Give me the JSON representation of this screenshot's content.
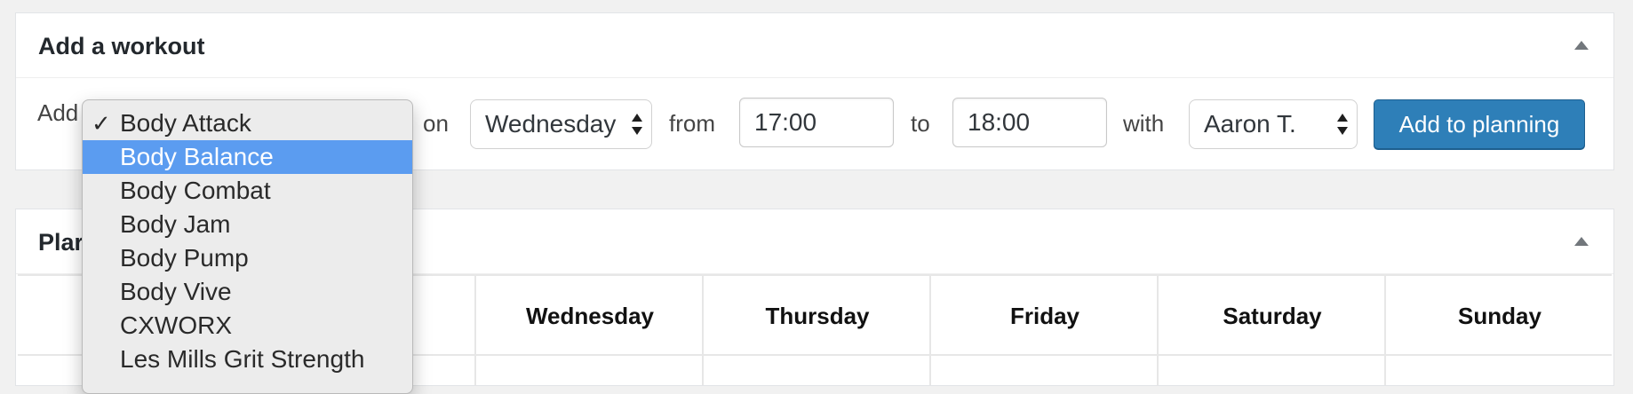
{
  "add_box": {
    "title": "Add a workout",
    "label_add": "Add",
    "label_on": "on",
    "label_from": "from",
    "label_to": "to",
    "label_with": "with",
    "day_select": "Wednesday",
    "from_value": "17:00",
    "to_value": "18:00",
    "trainer_select": "Aaron T.",
    "add_button": "Add to planning"
  },
  "workout_dropdown": {
    "checked_item": "Body Attack",
    "highlighted_item": "Body Balance",
    "items": [
      "Body Attack",
      "Body Balance",
      "Body Combat",
      "Body Jam",
      "Body Pump",
      "Body Vive",
      "CXWORX",
      "Les Mills Grit Strength"
    ],
    "check_mark": "✓"
  },
  "planning_box": {
    "title": "Plar",
    "days": [
      "Wednesday",
      "Thursday",
      "Friday",
      "Saturday",
      "Sunday"
    ]
  },
  "colors": {
    "button": "#2e7fb8",
    "highlight": "#5b9cf0"
  }
}
